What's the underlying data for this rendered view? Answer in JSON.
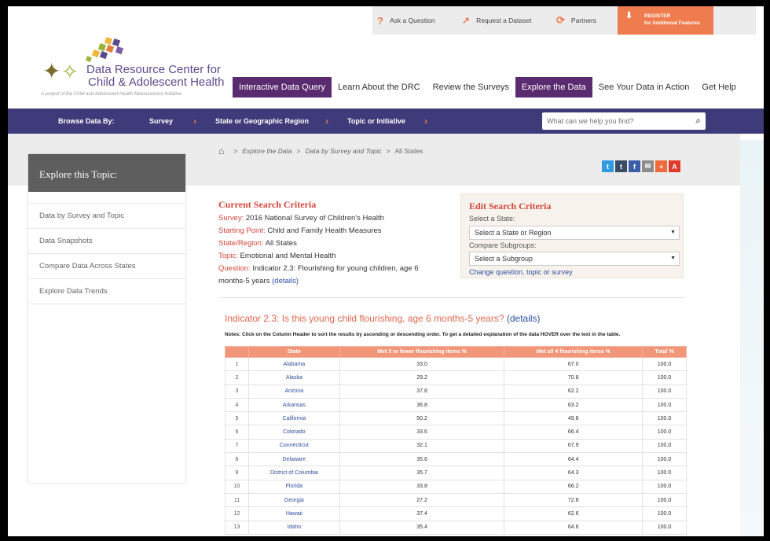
{
  "utility": {
    "ask": "Ask a Question",
    "request": "Request a Dataset",
    "partners": "Partners",
    "register_line1": "REGISTER",
    "register_line2": "for Additional Features"
  },
  "logo": {
    "line1": "Data Resource Center for",
    "line2": "Child & Adolescent Health",
    "tagline": "A project of the Child and Adolescent Health Measurement Initiative"
  },
  "mainnav": [
    "Interactive Data Query",
    "Learn About the DRC",
    "Review the Surveys",
    "Explore the Data",
    "See Your Data in Action",
    "Get Help"
  ],
  "browse": {
    "label": "Browse Data By:",
    "survey": "Survey",
    "state": "State or Geographic Region",
    "topic": "Topic or Initiative",
    "search_placeholder": "What can we help you find?"
  },
  "breadcrumb": {
    "explore": "Explore the Data",
    "bysurvey": "Data by Survey and Topic",
    "current": "All States"
  },
  "social": [
    "t",
    "t",
    "f",
    "✉",
    "+",
    "A"
  ],
  "sidebar": {
    "title": "Explore this Topic:",
    "items": [
      "Data by Survey and Topic",
      "Data Snapshots",
      "Compare Data Across States",
      "Explore Data Trends"
    ]
  },
  "criteria": {
    "title": "Current Search Criteria",
    "survey_label": "Survey:",
    "survey_value": "2016 National Survey of Children's Health",
    "start_label": "Starting Point:",
    "start_value": "Child and Family Health Measures",
    "region_label": "State/Region:",
    "region_value": "All States",
    "topic_label": "Topic:",
    "topic_value": "Emotional and Mental Health",
    "question_label": "Question:",
    "question_value": "Indicator 2.3: Flourishing for young children, age 6 months-5 years",
    "details": "(details)"
  },
  "edit": {
    "title": "Edit Search Criteria",
    "state_label": "Select a State:",
    "state_value": "Select a State or Region",
    "sub_label": "Compare Subgroups:",
    "sub_value": "Select a Subgroup",
    "change_link": "Change question, topic or survey"
  },
  "indicator": {
    "title": "Indicator 2.3: Is this young child flourishing, age 6 months-5 years?",
    "details": "(details)",
    "notes": "Notes: Click on the Column Header to sort the results by ascending or descending order. To get a detailed explanation of the data HOVER over the text in the table."
  },
  "table": {
    "headers": [
      "",
      "State",
      "Met 3 or fewer flourishing items %",
      "Met all 4 flourishing items %",
      "Total %"
    ],
    "rows": [
      [
        "1",
        "Alabama",
        "33.0",
        "67.0",
        "100.0"
      ],
      [
        "2",
        "Alaska",
        "29.2",
        "70.8",
        "100.0"
      ],
      [
        "3",
        "Arizona",
        "37.8",
        "62.2",
        "100.0"
      ],
      [
        "4",
        "Arkansas",
        "36.8",
        "63.2",
        "100.0"
      ],
      [
        "5",
        "California",
        "50.2",
        "49.8",
        "100.0"
      ],
      [
        "6",
        "Colorado",
        "33.6",
        "66.4",
        "100.0"
      ],
      [
        "7",
        "Connecticut",
        "32.1",
        "67.9",
        "100.0"
      ],
      [
        "8",
        "Delaware",
        "35.6",
        "64.4",
        "100.0"
      ],
      [
        "9",
        "District of Columbia",
        "35.7",
        "64.3",
        "100.0"
      ],
      [
        "10",
        "Florida",
        "33.8",
        "66.2",
        "100.0"
      ],
      [
        "11",
        "Georgia",
        "27.2",
        "72.8",
        "100.0"
      ],
      [
        "12",
        "Hawaii",
        "37.4",
        "62.6",
        "100.0"
      ],
      [
        "13",
        "Idaho",
        "35.4",
        "64.6",
        "100.0"
      ]
    ]
  },
  "colors": {
    "purple_nav": "#3f3a7a",
    "active_tab": "#5a2b6e",
    "accent_orange": "#ef7c4e",
    "criteria_red": "#d2453a",
    "table_header": "#f19678"
  }
}
